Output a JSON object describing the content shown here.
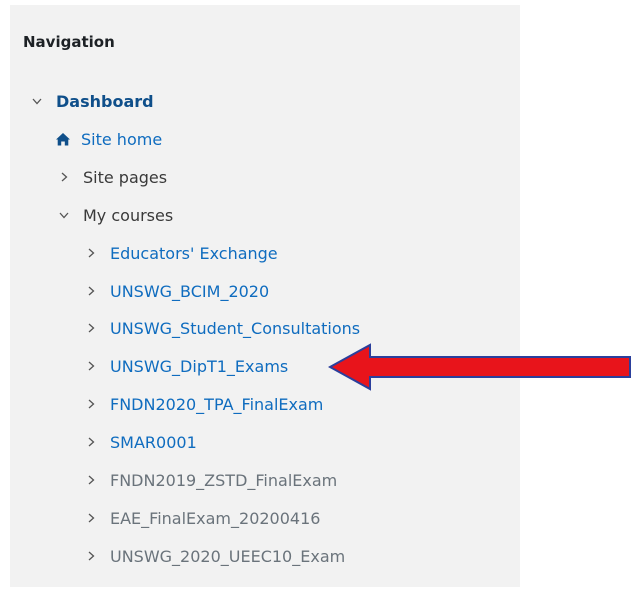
{
  "nav": {
    "title": "Navigation",
    "dashboard": "Dashboard",
    "site_home": "Site home",
    "site_pages": "Site pages",
    "my_courses": "My courses",
    "courses": [
      {
        "label": "Educators' Exchange",
        "style": "link"
      },
      {
        "label": "UNSWG_BCIM_2020",
        "style": "link"
      },
      {
        "label": "UNSWG_Student_Consultations",
        "style": "link"
      },
      {
        "label": "UNSWG_DipT1_Exams",
        "style": "link"
      },
      {
        "label": "FNDN2020_TPA_FinalExam",
        "style": "link"
      },
      {
        "label": "SMAR0001",
        "style": "link"
      },
      {
        "label": "FNDN2019_ZSTD_FinalExam",
        "style": "grey"
      },
      {
        "label": "EAE_FinalExam_20200416",
        "style": "grey"
      },
      {
        "label": "UNSWG_2020_UEEC10_Exam",
        "style": "grey"
      }
    ]
  },
  "annotation": {
    "arrow_color": "#e8141b",
    "arrow_outline": "#2b3f9c",
    "target": "UNSWG_DipT1_Exams"
  },
  "colors": {
    "panel_bg": "#f2f2f2",
    "link": "#0f6cbf",
    "muted": "#6a737b"
  },
  "icons": {
    "expanded": "chevron-down-icon",
    "collapsed": "chevron-right-icon",
    "home": "home-icon"
  }
}
